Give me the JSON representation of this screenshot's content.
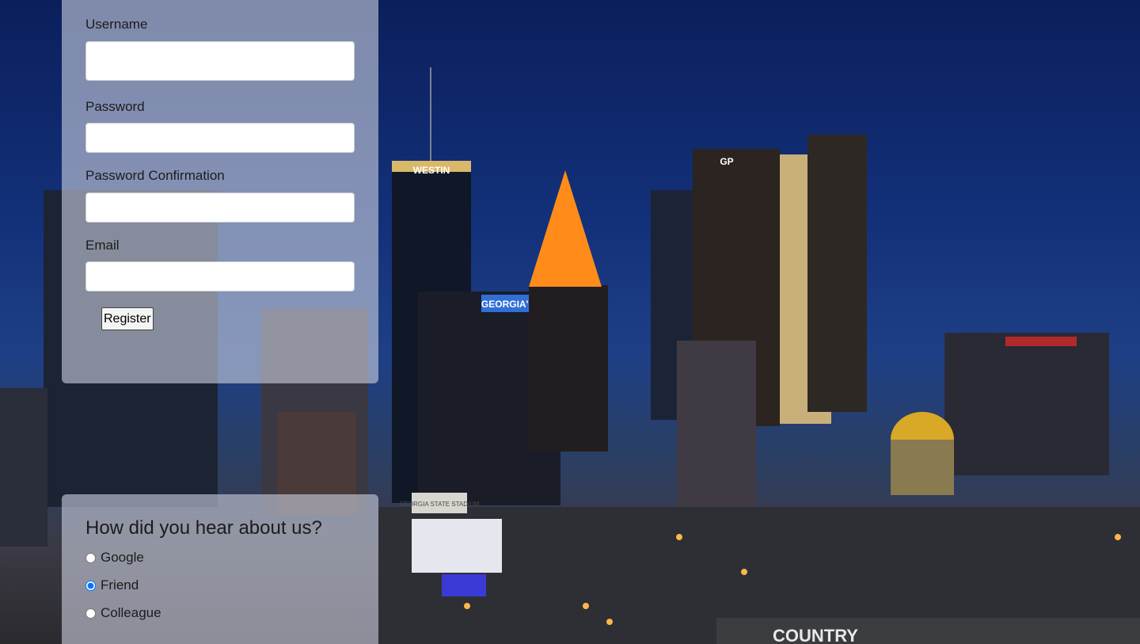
{
  "registration": {
    "username_label": "Username",
    "username_value": "",
    "password_label": "Password",
    "password_value": "",
    "password_confirmation_label": "Password Confirmation",
    "password_confirmation_value": "",
    "email_label": "Email",
    "email_value": "",
    "register_button_label": "Register"
  },
  "survey": {
    "title": "How did you hear about us?",
    "options": [
      {
        "label": "Google",
        "checked": false
      },
      {
        "label": "Friend",
        "checked": true
      },
      {
        "label": "Colleague",
        "checked": false
      }
    ]
  },
  "background": {
    "signs": {
      "westin": "WESTIN",
      "georgias_own": "GEORGIA'S OWN",
      "gp": "GP",
      "georgia_state_stadium": "GEORGIA STATE STADIUM",
      "country": "COUNTRY"
    }
  },
  "colors": {
    "sky_top": "#0b1f5c",
    "panel_bg": "rgba(200,205,220,0.62)",
    "spire_orange": "#ff8c1a",
    "dome_gold": "#d9a826"
  }
}
